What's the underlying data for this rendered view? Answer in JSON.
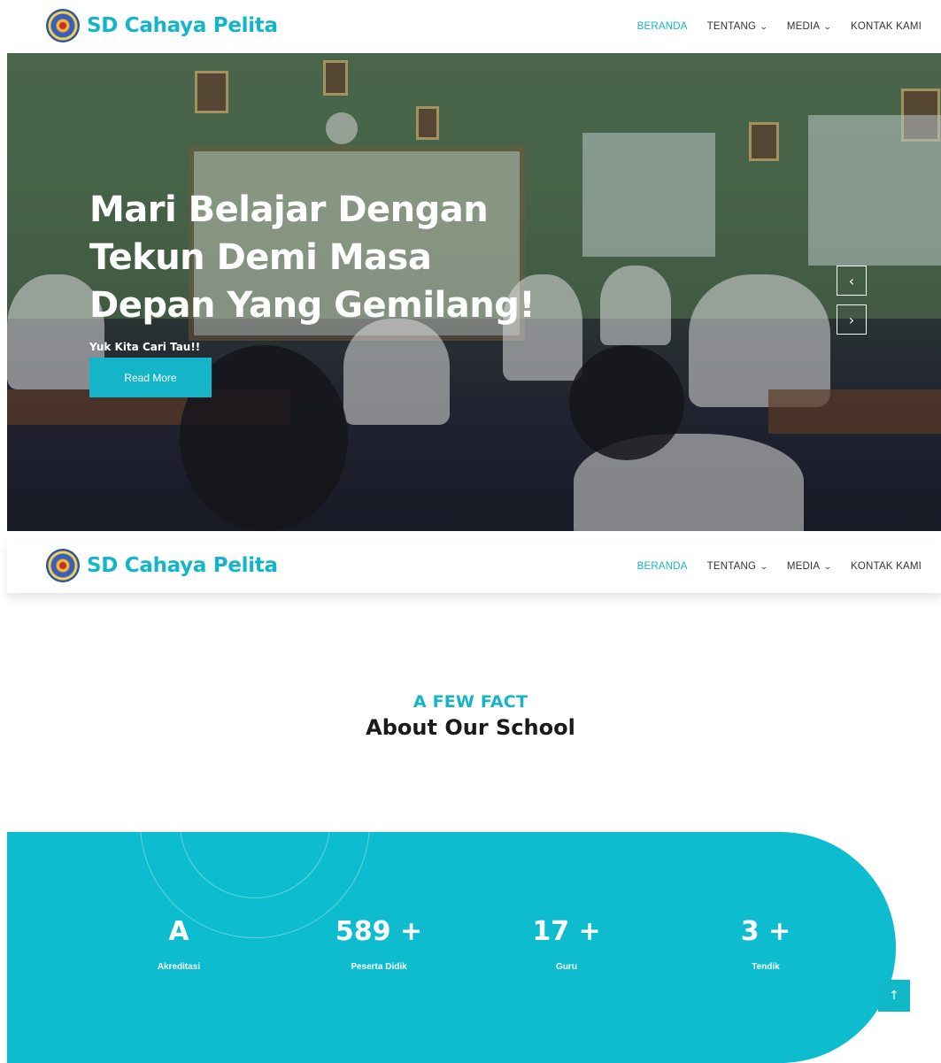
{
  "brand": {
    "name": "SD Cahaya Pelita",
    "logo": "school-emblem-logo"
  },
  "nav": {
    "items": [
      {
        "label": "BERANDA",
        "active": true,
        "dropdown": false
      },
      {
        "label": "TENTANG",
        "active": false,
        "dropdown": true
      },
      {
        "label": "MEDIA",
        "active": false,
        "dropdown": true
      },
      {
        "label": "KONTAK KAMI",
        "active": false,
        "dropdown": false
      }
    ],
    "chevron": "⌄"
  },
  "hero": {
    "title_lines": [
      "Mari Belajar Dengan",
      "Tekun Demi Masa",
      "Depan Yang Gemilang!"
    ],
    "subtitle": "Yuk Kita Cari Tau!!",
    "button_label": "Read More",
    "prev_icon": "‹",
    "next_icon": "›"
  },
  "facts": {
    "kicker": "A FEW FACT",
    "title": "About Our School",
    "stats": [
      {
        "value": "A",
        "label": "Akreditasi"
      },
      {
        "value": "589 +",
        "label": "Peserta Didik"
      },
      {
        "value": "17 +",
        "label": "Guru"
      },
      {
        "value": "3 +",
        "label": "Tendik"
      }
    ]
  },
  "back_to_top": {
    "icon": "↑"
  },
  "colors": {
    "accent": "#14b5c9",
    "band": "#0dbcce",
    "white": "#ffffff"
  }
}
